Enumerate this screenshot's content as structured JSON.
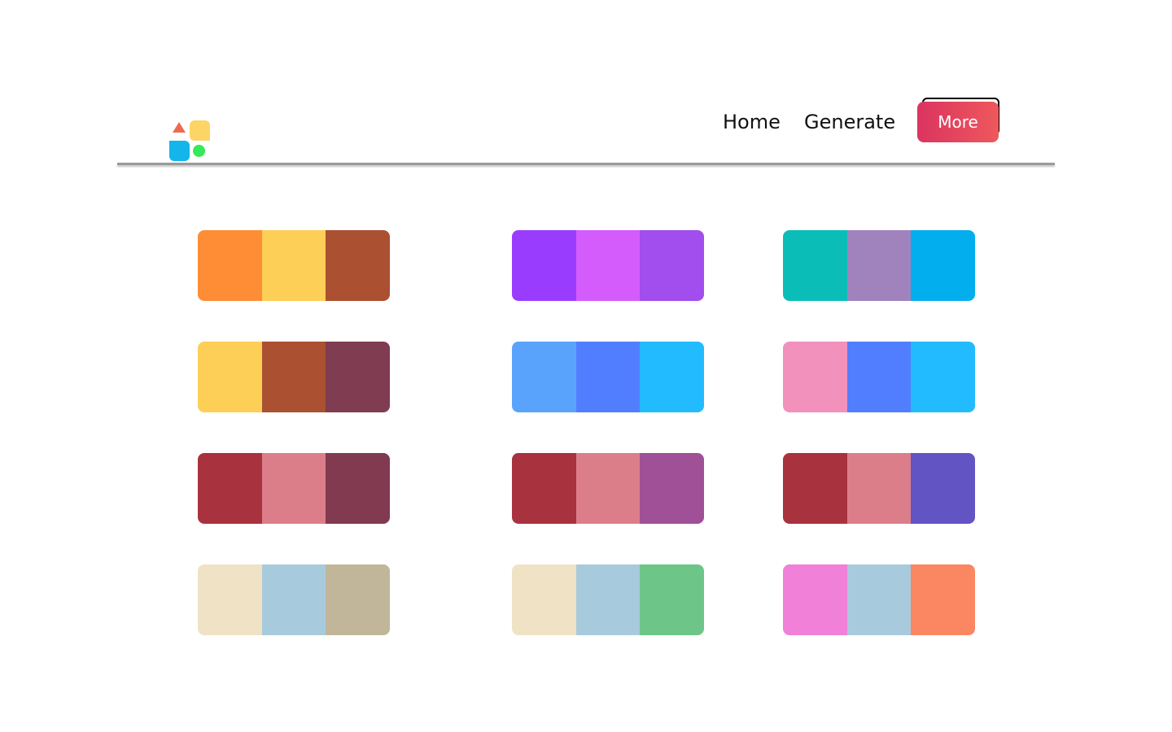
{
  "nav": {
    "home": "Home",
    "generate": "Generate",
    "more": "More"
  },
  "logo": {
    "colors": [
      "#ee6a4e",
      "#fdd566",
      "#13b5ea",
      "#34ea57"
    ]
  },
  "palettes": [
    [
      "#fe8d35",
      "#fdcf57",
      "#ab5031"
    ],
    [
      "#9a3cfe",
      "#d45cfd",
      "#a24ded"
    ],
    [
      "#0bbdb7",
      "#a083bd",
      "#03aeee"
    ],
    [
      "#fdcf57",
      "#ab5031",
      "#803c50"
    ],
    [
      "#5aa3fd",
      "#517eff",
      "#22bbff"
    ],
    [
      "#f191bc",
      "#517eff",
      "#22bbff"
    ],
    [
      "#a9323f",
      "#dc7e89",
      "#813a4f"
    ],
    [
      "#a9323f",
      "#dc7e89",
      "#9f5097"
    ],
    [
      "#a9323f",
      "#dc7e89",
      "#6354c4"
    ],
    [
      "#f0e2c5",
      "#a8cadd",
      "#c1b699"
    ],
    [
      "#f0e2c5",
      "#a8cadd",
      "#6dc688"
    ],
    [
      "#f080d8",
      "#a8cadd",
      "#fa8662"
    ]
  ]
}
